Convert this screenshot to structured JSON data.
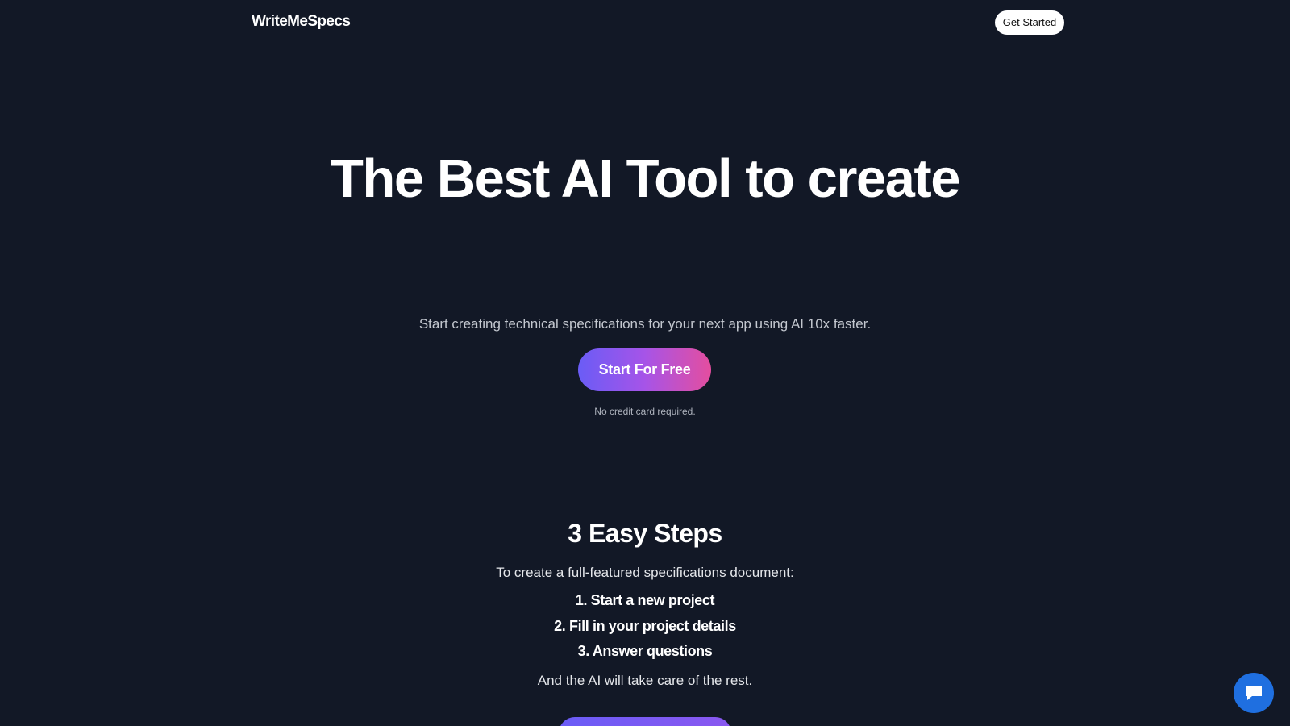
{
  "nav": {
    "brand": "WriteMeSpecs",
    "cta_label": "Get Started"
  },
  "hero": {
    "title": "The Best AI Tool to create",
    "subtitle": "Start creating technical specifications for your next app using AI 10x faster.",
    "cta_label": "Start For Free",
    "cta_note": "No credit card required."
  },
  "steps": {
    "title": "3 Easy Steps",
    "intro": "To create a full-featured specifications document:",
    "items": [
      "1. Start a new project",
      "2. Fill in your project details",
      "3. Answer questions"
    ],
    "outro": "And the AI will take care of the rest."
  },
  "widgets": {
    "chat_icon": "chat-bubble-icon"
  },
  "colors": {
    "background": "#121826",
    "cta_gradient_start": "#6a5cf6",
    "cta_gradient_end": "#e44e9f",
    "chat_button": "#1f6fe0"
  }
}
